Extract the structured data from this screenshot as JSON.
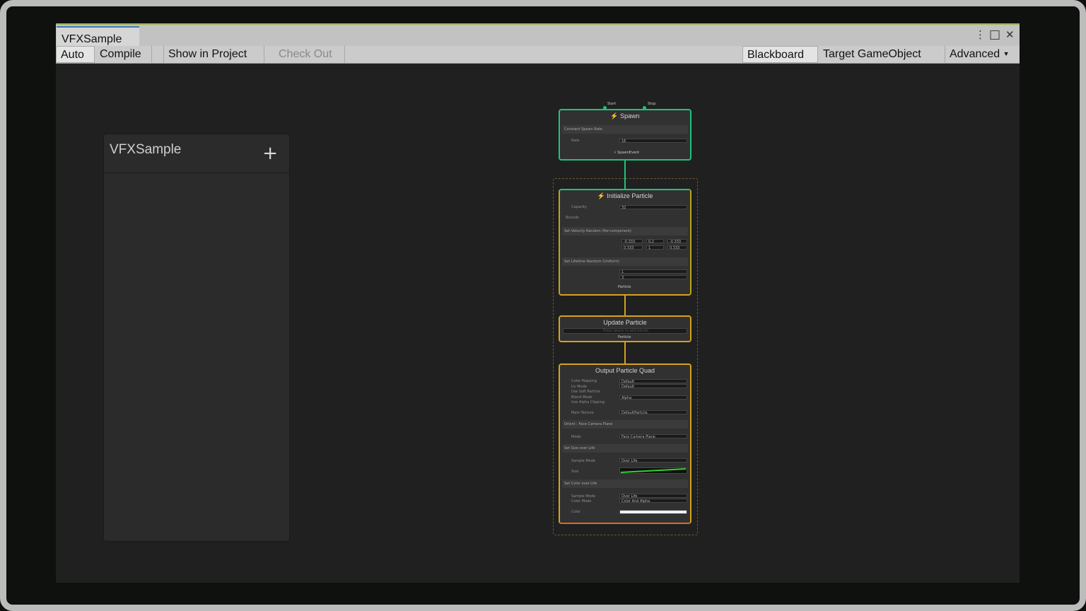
{
  "window": {
    "tab_title": "VFXSample",
    "controls": {
      "menu": "⋮",
      "maximize": "□",
      "close": "✕"
    }
  },
  "toolbar": {
    "auto": "Auto",
    "compile": "Compile",
    "show_in_project": "Show in Project",
    "check_out": "Check Out",
    "blackboard": "Blackboard",
    "target_gameobject": "Target GameObject",
    "advanced": "Advanced"
  },
  "blackboard": {
    "title": "VFXSample",
    "add": "+"
  },
  "graph": {
    "spawn": {
      "title": "Spawn",
      "port_start": "Start",
      "port_stop": "Stop",
      "block": "Constant Spawn Rate",
      "rate_label": "Rate",
      "rate_value": "16",
      "output": "SpawnEvent"
    },
    "initialize": {
      "title": "Initialize Particle",
      "capacity_label": "Capacity",
      "capacity_value": "32",
      "bounds_label": "Bounds",
      "block_velocity": "Set Velocity Random (Per-component)",
      "velocity_a": [
        "-0.333",
        "0.2",
        "-0.333"
      ],
      "velocity_b": [
        "0.333",
        "1",
        "0.333"
      ],
      "block_lifetime": "Set Lifetime Random (Uniform)",
      "lifetime_a": "1",
      "lifetime_b": "3",
      "output": "Particle"
    },
    "update": {
      "title": "Update Particle",
      "empty_hint": "Press space to add blocks",
      "output": "Particle"
    },
    "output": {
      "title": "Output Particle Quad",
      "color_mapping_label": "Color Mapping",
      "color_mapping_value": "Default",
      "uv_mode_label": "Uv Mode",
      "uv_mode_value": "Default",
      "use_soft_particle": "Use Soft Particle",
      "blend_mode_label": "Blend Mode",
      "blend_mode_value": "Alpha",
      "use_alpha_clipping": "Use Alpha Clipping",
      "main_texture_label": "Main Texture",
      "main_texture_value": "DefaultParticle",
      "block_orient": "Orient : Face Camera Plane",
      "mode_label": "Mode",
      "mode_value": "Face Camera Plane",
      "block_size": "Set Size over Life",
      "sample_mode_label": "Sample Mode",
      "sample_mode_value": "Over Life",
      "size_label": "Size",
      "block_color": "Set Color over Life",
      "color_sample_mode_value": "Over Life",
      "color_mode_label": "Color Mode",
      "color_mode_value": "Color And Alpha",
      "color_label": "Color"
    }
  },
  "colors": {
    "spawn": "#21c17c",
    "initialize": "#d6a21e",
    "update": "#d6a21e",
    "output": "#d86a28"
  }
}
